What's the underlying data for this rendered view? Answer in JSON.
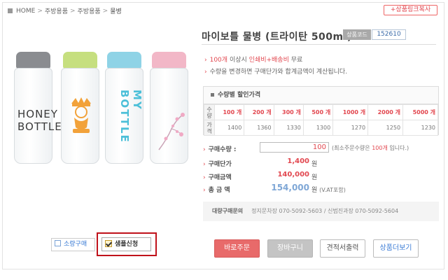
{
  "breadcrumb": {
    "items": [
      "HOME",
      "주방용품",
      "주방용품",
      "물병"
    ]
  },
  "link_copy_button": "+상품링크복사",
  "product": {
    "title": "마이보틀 물병 (트라이탄 500ml)",
    "code_label": "상품코드",
    "code_value": "152610",
    "bottle_prints": [
      "HONEY",
      "BOTTLE",
      "MY BOTTLE"
    ],
    "bottle_colors": [
      "#8a8c90",
      "#c6df7f",
      "#8fd3e6",
      "#f2b7c7"
    ]
  },
  "notices": {
    "n1_qty": "100개",
    "n1_mid": " 이상시 ",
    "n1_highlight": "인쇄비+배송비",
    "n1_end": " 무료",
    "n2": "수량을 변경하면 구매단가와 합계금액이 계산됩니다."
  },
  "price_table": {
    "title": "수량별 할인가격",
    "qty_header": "수량",
    "price_header": "가격",
    "rows": [
      {
        "qty": "100 개",
        "price": "1400"
      },
      {
        "qty": "200 개",
        "price": "1360"
      },
      {
        "qty": "300 개",
        "price": "1330"
      },
      {
        "qty": "500 개",
        "price": "1300"
      },
      {
        "qty": "1000 개",
        "price": "1270"
      },
      {
        "qty": "2000 개",
        "price": "1250"
      },
      {
        "qty": "5000 개",
        "price": "1230"
      }
    ]
  },
  "order": {
    "qty_label": "구매수량 :",
    "qty_value": "100",
    "qty_note_pre": "(최소주문수량은 ",
    "qty_note_num": "100개",
    "qty_note_post": " 입니다.)",
    "unit_label": "구매단가",
    "unit_value": "1,400",
    "sum_label": "구매금액",
    "sum_value": "140,000",
    "total_label": "총 금 액",
    "total_value": "154,000",
    "currency": "원",
    "vat_note": "(V.AT포함)"
  },
  "contact": {
    "label": "대량구매문의",
    "text": "정지문차장 070-5092-5603 / 신범진과장 070-5092-5604"
  },
  "buttons": {
    "order": "바로주문",
    "cart": "장바구니",
    "quote": "견적서출력",
    "more": "상품더보기",
    "small_buy": "소량구매",
    "sample": "샘플신청"
  }
}
